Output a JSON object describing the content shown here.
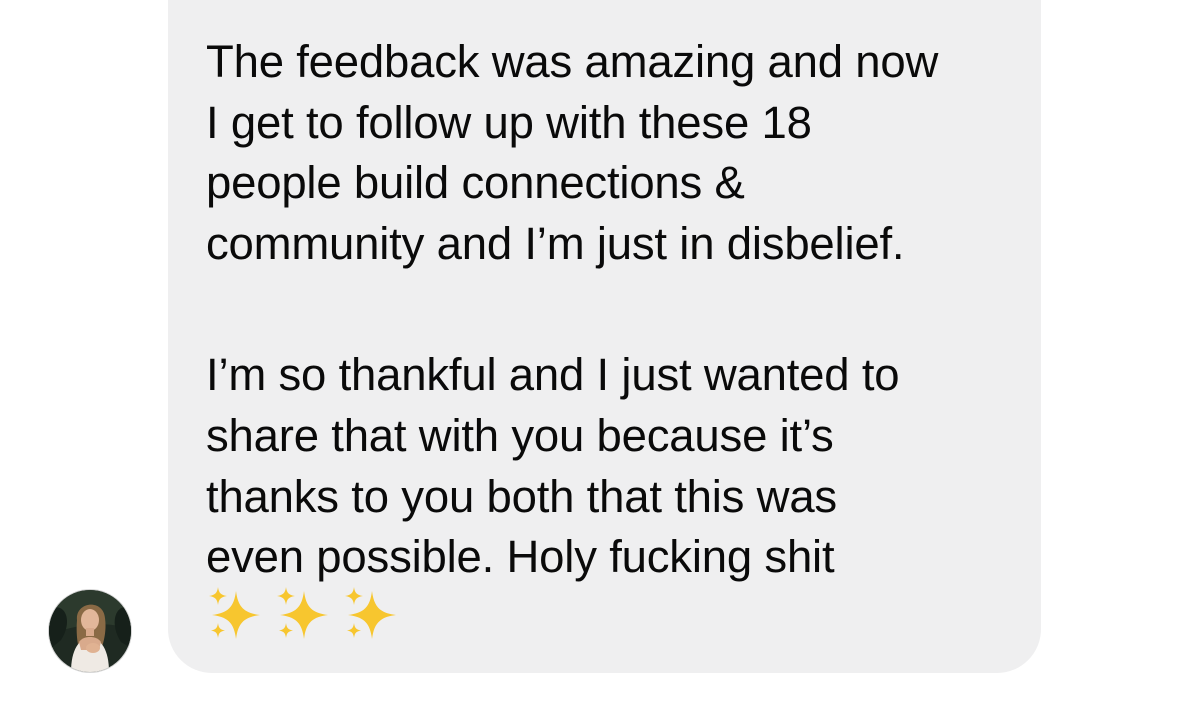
{
  "chat": {
    "message": {
      "paragraph1": [
        "The feedback was amazing and now",
        "I get to follow up with these 18",
        "people build connections &",
        "community and I’m just in disbelief."
      ],
      "paragraph2": [
        "I’m so thankful and I just wanted to",
        "share that with you because it’s",
        "thanks to you both that this was",
        "even possible. Holy fucking shit"
      ],
      "emoji": [
        "sparkles-icon",
        "sparkles-icon",
        "sparkles-icon"
      ]
    },
    "sender": {
      "avatar_icon": "profile-photo"
    }
  },
  "colors": {
    "bubble_bg": "#efeff0",
    "text": "#0a0a0a",
    "sparkle": "#f7c62f"
  }
}
